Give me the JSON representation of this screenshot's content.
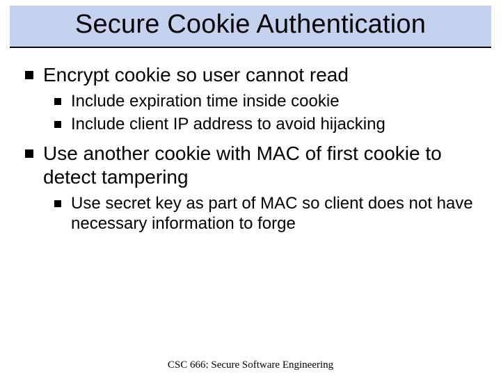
{
  "slide": {
    "title": "Secure Cookie Authentication",
    "bullets": [
      {
        "text": "Encrypt cookie so user cannot read",
        "sub": [
          "Include expiration time inside cookie",
          "Include client IP address to avoid hijacking"
        ]
      },
      {
        "text": "Use another cookie with MAC of first cookie to detect tampering",
        "sub": [
          "Use secret key as part of MAC so client does not have necessary information to forge"
        ]
      }
    ],
    "footer": "CSC 666: Secure Software Engineering"
  }
}
